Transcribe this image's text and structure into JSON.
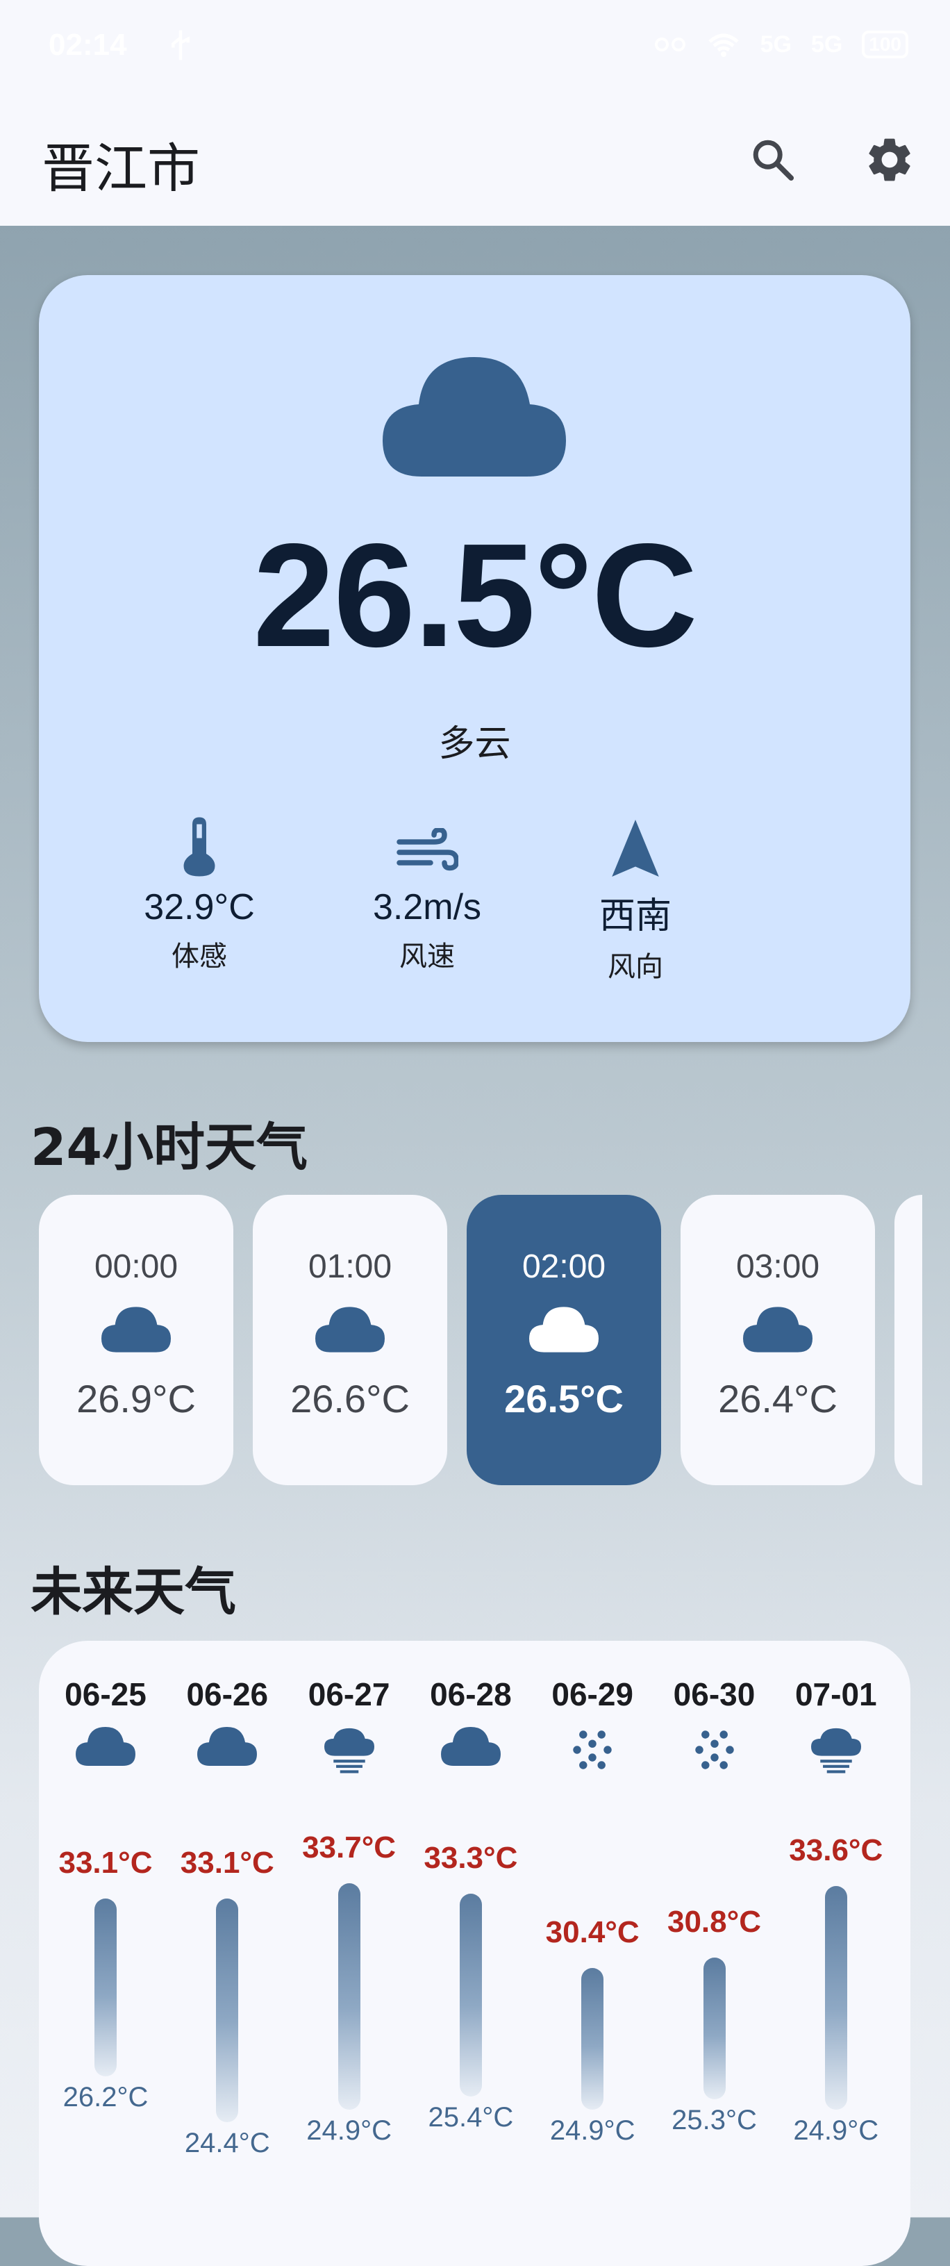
{
  "status_bar": {
    "time": "02:14",
    "signal_1": "5G",
    "signal_2": "5G",
    "battery": "100"
  },
  "app_bar": {
    "city": "晋江市",
    "search_icon": "search-icon",
    "settings_icon": "gear-icon"
  },
  "current": {
    "icon": "cloud-icon",
    "temperature": "26.5°C",
    "description": "多云",
    "stats": [
      {
        "icon": "thermometer-icon",
        "value": "32.9°C",
        "label": "体感"
      },
      {
        "icon": "wind-icon",
        "value": "3.2m/s",
        "label": "风速"
      },
      {
        "icon": "navigation-arrow-icon",
        "value": "西南",
        "label": "风向"
      }
    ]
  },
  "hourly": {
    "title": "24小时天气",
    "items": [
      {
        "time": "00:00",
        "icon": "cloud-icon",
        "temp": "26.9°C",
        "active": false
      },
      {
        "time": "01:00",
        "icon": "cloud-icon",
        "temp": "26.6°C",
        "active": false
      },
      {
        "time": "02:00",
        "icon": "cloud-icon",
        "temp": "26.5°C",
        "active": true
      },
      {
        "time": "03:00",
        "icon": "cloud-icon",
        "temp": "26.4°C",
        "active": false
      }
    ]
  },
  "daily": {
    "title": "未来天气",
    "items": [
      {
        "date": "06-25",
        "icon": "cloud-icon",
        "max": "33.1°C",
        "min": "26.2°C",
        "max_value": 33.1,
        "min_value": 26.2
      },
      {
        "date": "06-26",
        "icon": "cloud-icon",
        "max": "33.1°C",
        "min": "24.4°C",
        "max_value": 33.1,
        "min_value": 24.4
      },
      {
        "date": "06-27",
        "icon": "cloud-rain-icon",
        "max": "33.7°C",
        "min": "24.9°C",
        "max_value": 33.7,
        "min_value": 24.9
      },
      {
        "date": "06-28",
        "icon": "cloud-icon",
        "max": "33.3°C",
        "min": "25.4°C",
        "max_value": 33.3,
        "min_value": 25.4
      },
      {
        "date": "06-29",
        "icon": "drizzle-dots-icon",
        "max": "30.4°C",
        "min": "24.9°C",
        "max_value": 30.4,
        "min_value": 24.9
      },
      {
        "date": "06-30",
        "icon": "drizzle-dots-icon",
        "max": "30.8°C",
        "min": "25.3°C",
        "max_value": 30.8,
        "min_value": 25.3
      },
      {
        "date": "07-01",
        "icon": "cloud-rain-icon",
        "max": "33.6°C",
        "min": "24.9°C",
        "max_value": 33.6,
        "min_value": 24.9
      }
    ]
  },
  "colors": {
    "accent": "#37618e",
    "card": "#d2e4ff",
    "surface": "#f7f8fd",
    "max_temp": "#b3261e",
    "min_temp": "#44688f"
  }
}
